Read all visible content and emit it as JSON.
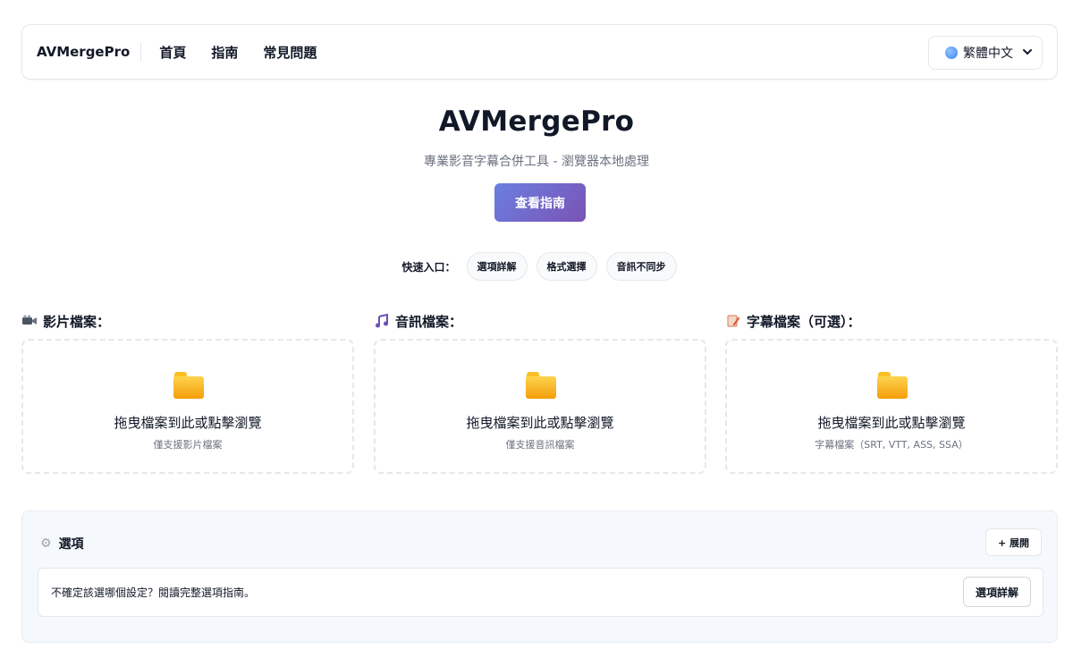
{
  "nav": {
    "brand": "AVMergePro",
    "links": [
      "首頁",
      "指南",
      "常見問題"
    ],
    "language": "繁體中文"
  },
  "hero": {
    "title": "AVMergePro",
    "subtitle": "專業影音字幕合併工具 - 瀏覽器本地處理",
    "guide_button": "查看指南"
  },
  "quick": {
    "label": "快速入口：",
    "chips": [
      "選項詳解",
      "格式選擇",
      "音訊不同步"
    ]
  },
  "uploads": [
    {
      "icon": "video-camera-icon",
      "label": "影片檔案：",
      "prompt": "拖曳檔案到此或點擊瀏覽",
      "hint": "僅支援影片檔案"
    },
    {
      "icon": "music-note-icon",
      "label": "音訊檔案：",
      "prompt": "拖曳檔案到此或點擊瀏覽",
      "hint": "僅支援音訊檔案"
    },
    {
      "icon": "document-pencil-icon",
      "label": "字幕檔案（可選）：",
      "prompt": "拖曳檔案到此或點擊瀏覽",
      "hint": "字幕檔案（SRT, VTT, ASS, SSA）"
    }
  ],
  "options": {
    "title": "選項",
    "expand_button": "+ 展開",
    "help_text": "不確定該選哪個設定？閱讀完整選項指南。",
    "detail_button": "選項詳解"
  },
  "colors": {
    "accent_start": "#6b7fe0",
    "accent_end": "#7a53b5",
    "folder": "#fbbf24"
  }
}
